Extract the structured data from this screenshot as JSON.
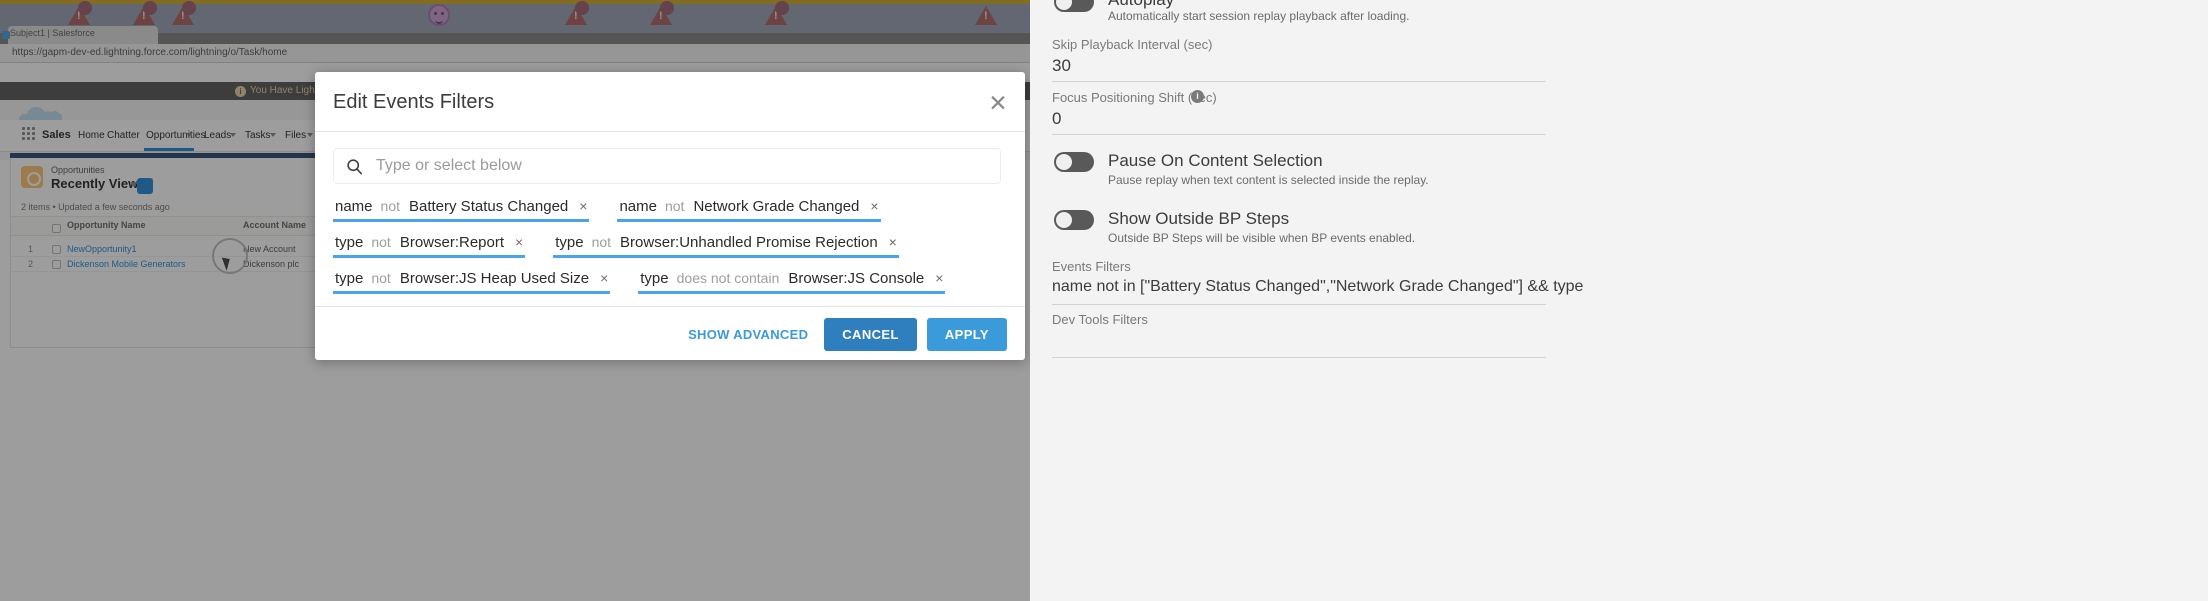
{
  "browser": {
    "tab_title": "Subject1 | Salesforce",
    "url": "https://gapm-dev-ed.lightning.force.com/lightning/o/Task/home",
    "banner_text": "You Have Lightning Components In Your Org",
    "banner_icon": "info-icon",
    "app_name": "Sales",
    "nav_items": [
      "Home",
      "Chatter",
      "Opportunities",
      "Leads",
      "Tasks",
      "Files"
    ],
    "list_eyebrow": "Opportunities",
    "list_title": "Recently Viewed",
    "list_meta": "2 items • Updated a few seconds ago",
    "columns": [
      "Opportunity Name",
      "Account Name"
    ],
    "rows": [
      {
        "num": "1",
        "opportunity": "NewOpportunity1",
        "account": "New Account"
      },
      {
        "num": "2",
        "opportunity": "Dickenson Mobile Generators",
        "account": "Dickenson plc"
      }
    ]
  },
  "modal": {
    "title": "Edit Events Filters",
    "close_icon": "close-icon",
    "search": {
      "icon": "search-icon",
      "value": "",
      "placeholder": "Type or select below"
    },
    "chips": [
      [
        {
          "field": "name",
          "op": "not",
          "value": "Battery Status Changed",
          "remove": "×"
        },
        {
          "field": "name",
          "op": "not",
          "value": "Network Grade Changed",
          "remove": "×"
        }
      ],
      [
        {
          "field": "type",
          "op": "not",
          "value": "Browser:Report",
          "remove": "×"
        },
        {
          "field": "type",
          "op": "not",
          "value": "Browser:Unhandled Promise Rejection",
          "remove": "×"
        }
      ],
      [
        {
          "field": "type",
          "op": "not",
          "value": "Browser:JS Heap Used Size",
          "remove": "×"
        },
        {
          "field": "type",
          "op": "does not contain",
          "value": "Browser:JS Console",
          "remove": "×"
        }
      ]
    ],
    "footer": {
      "show_advanced": "SHOW ADVANCED",
      "cancel": "CANCEL",
      "apply": "APPLY"
    }
  },
  "settings": {
    "autoplay": {
      "title": "Autoplay",
      "subtitle": "Automatically start session replay playback after loading.",
      "state": "off"
    },
    "skip_playback": {
      "label": "Skip Playback Interval (sec)",
      "value": "30"
    },
    "focus_shift": {
      "label": "Focus Positioning Shift (sec)",
      "info_icon": "info-icon",
      "value": "0"
    },
    "pause_on_content": {
      "title": "Pause On Content Selection",
      "subtitle": "Pause replay when text content is selected inside the replay.",
      "state": "off"
    },
    "show_outside_bp": {
      "title": "Show Outside BP Steps",
      "subtitle": "Outside BP Steps will be visible when BP events enabled.",
      "state": "off"
    },
    "events_filters": {
      "label": "Events Filters",
      "value": "name not in [\"Battery Status Changed\",\"Network Grade Changed\"] && type"
    },
    "dev_tools_filters": {
      "label": "Dev Tools Filters",
      "value": ""
    }
  },
  "colors": {
    "accent_blue": "#3b9ad9",
    "chip_underline": "#4ba3ef",
    "cancel_blue": "#2f7fbf",
    "panel_bg": "#f3f3f3"
  }
}
